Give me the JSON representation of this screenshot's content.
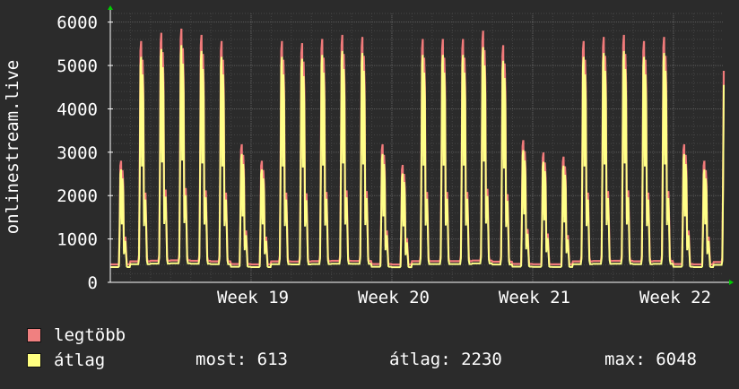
{
  "chart_data": {
    "type": "line",
    "ylabel": "onlinestream.live",
    "ylim": [
      0,
      6200
    ],
    "yticks": [
      0,
      1000,
      2000,
      3000,
      4000,
      5000,
      6000
    ],
    "ytick_labels": [
      "0",
      "1000",
      "2000",
      "3000",
      "4000",
      "5000",
      "6000"
    ],
    "xticks": [
      {
        "label": "Week 19",
        "day": 7
      },
      {
        "label": "Week 20",
        "day": 14
      },
      {
        "label": "Week 21",
        "day": 21
      },
      {
        "label": "Week 22",
        "day": 28
      }
    ],
    "x_unit": "day",
    "x_range": [
      0,
      30.5
    ],
    "daily_peaks": [
      2900,
      5800,
      6000,
      6100,
      5950,
      5800,
      3300,
      2900,
      5800,
      5750,
      5850,
      5950,
      5900,
      3300,
      2800,
      5850,
      5850,
      5850,
      6050,
      5700,
      3400,
      3100,
      3000,
      5800,
      5900,
      5950,
      5800,
      5900,
      3300,
      2900,
      5300
    ],
    "grid": true,
    "series": [
      {
        "name": "legtöbb",
        "color": "#f07a7a",
        "role": "max"
      },
      {
        "name": "átlag",
        "color": "#ffff88",
        "role": "avg"
      }
    ]
  },
  "legend": {
    "max_label": "legtöbb",
    "avg_label": "átlag",
    "max_color": "#f08080",
    "avg_color": "#ffff80"
  },
  "stats": {
    "most": "most: 613",
    "atlag": "átlag: 2230",
    "max": "max: 6048"
  },
  "colors": {
    "background": "#2b2b2b",
    "plot_background": "#2b2b2b",
    "grid": "#5a5a5a",
    "axis": "#ffffff",
    "arrow": "#00cc00"
  }
}
